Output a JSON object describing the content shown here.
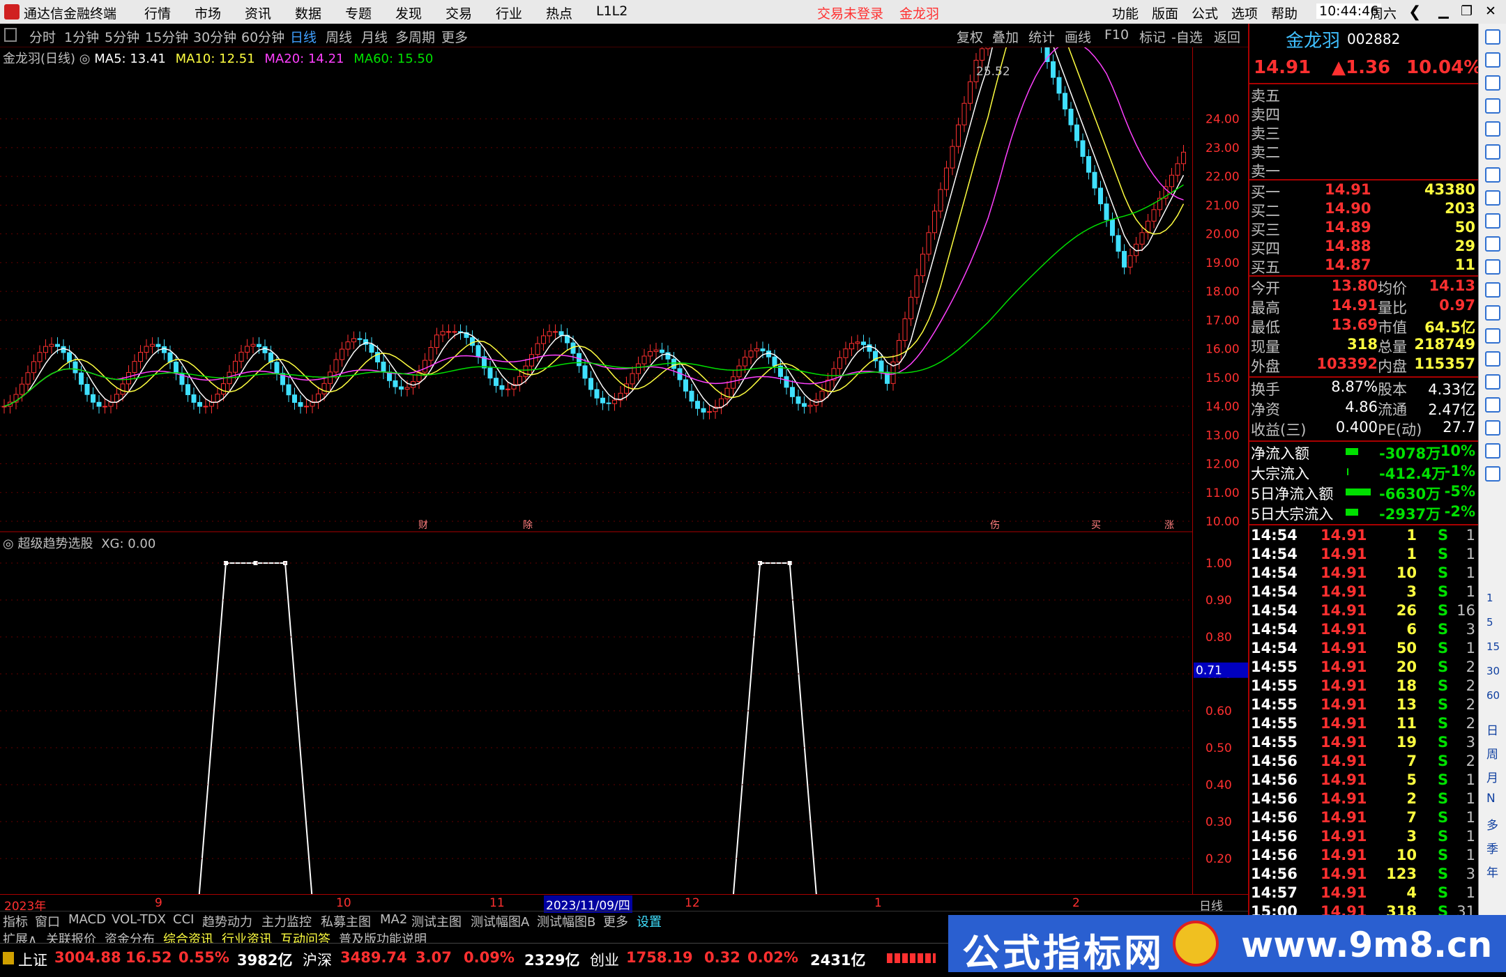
{
  "titlebar": {
    "app": "通达信金融终端",
    "menus": [
      "行情",
      "市场",
      "资讯",
      "数据",
      "专题",
      "发现",
      "交易",
      "行业",
      "热点",
      "L1L2"
    ],
    "login": "交易未登录",
    "stock": "金龙羽",
    "right_menus": [
      "功能",
      "版面",
      "公式",
      "选项",
      "帮助"
    ],
    "time": "10:44:46",
    "weekday": "周六"
  },
  "toolbar": {
    "periods": [
      "分时",
      "1分钟",
      "5分钟",
      "15分钟",
      "30分钟",
      "60分钟",
      "日线",
      "周线",
      "月线",
      "多周期",
      "更多"
    ],
    "active": "日线",
    "tools": [
      "复权",
      "叠加",
      "统计",
      "画线",
      "F10",
      "标记",
      "-自选",
      "返回"
    ]
  },
  "kline": {
    "title": "金龙羽(日线)",
    "ma5": "MA5: 13.41",
    "ma10": "MA10: 12.51",
    "ma20": "MA20: 14.21",
    "ma60": "MA60: 15.50",
    "high_label": "25.52",
    "yticks": [
      "24.00",
      "23.00",
      "22.00",
      "21.00",
      "20.00",
      "19.00",
      "18.00",
      "17.00",
      "16.00",
      "15.00",
      "14.00",
      "13.00",
      "12.00",
      "11.00",
      "10.00"
    ],
    "markers": [
      "财",
      "除",
      "伤",
      "买",
      "涨"
    ]
  },
  "indicator": {
    "title": "超级趋势选股",
    "value": "XG: 0.00",
    "yticks": [
      "1.00",
      "0.90",
      "0.80",
      "0.70",
      "0.60",
      "0.50",
      "0.40",
      "0.30",
      "0.20"
    ],
    "cursor": "0.71"
  },
  "chart_data": {
    "type": "line",
    "title": "超级趋势选股 XG",
    "ylim": [
      0,
      1
    ],
    "y": [
      0,
      0,
      0,
      0,
      0,
      0,
      0,
      1,
      1,
      1,
      0,
      0,
      0,
      0,
      0,
      0,
      0,
      0,
      0,
      0,
      0,
      0,
      0,
      0,
      0,
      1,
      1,
      0,
      0,
      0,
      0,
      0,
      0,
      0,
      0,
      0,
      0,
      0,
      0,
      0
    ]
  },
  "dates": {
    "labels": [
      "2023年",
      "9",
      "10",
      "11",
      "2023/11/09/四",
      "12",
      "1",
      "2"
    ],
    "period": "日线"
  },
  "tabs1": [
    "指标",
    "窗口",
    "MACD",
    "VOL-TDX",
    "CCI",
    "趋势动力",
    "主力监控",
    "私募主图",
    "MA2",
    "测试主图",
    "测试幅图A",
    "测试幅图B",
    "更多",
    "设置"
  ],
  "tabs2": [
    "扩展∧",
    "关联报价",
    "资金分布",
    "综合资讯",
    "行业资讯",
    "互动问答",
    "普及版功能说明"
  ],
  "quote": {
    "name": "金龙羽",
    "code": "002882",
    "price": "14.91",
    "change": "▲1.36",
    "pct": "10.04%",
    "sells": [
      "卖五",
      "卖四",
      "卖三",
      "卖二",
      "卖一"
    ],
    "buys": [
      [
        "买一",
        "14.91",
        "43380"
      ],
      [
        "买二",
        "14.90",
        "203"
      ],
      [
        "买三",
        "14.89",
        "50"
      ],
      [
        "买四",
        "14.88",
        "29"
      ],
      [
        "买五",
        "14.87",
        "11"
      ]
    ],
    "stats": [
      [
        "今开",
        "13.80",
        "均价",
        "14.13"
      ],
      [
        "最高",
        "14.91",
        "量比",
        "0.97"
      ],
      [
        "最低",
        "13.69",
        "市值",
        "64.5亿"
      ],
      [
        "现量",
        "318",
        "总量",
        "218749"
      ],
      [
        "外盘",
        "103392",
        "内盘",
        "115357"
      ]
    ],
    "fin": [
      [
        "换手",
        "8.87%",
        "股本",
        "4.33亿"
      ],
      [
        "净资",
        "4.86",
        "流通",
        "2.47亿"
      ],
      [
        "收益(三)",
        "0.400",
        "PE(动)",
        "27.7"
      ]
    ],
    "flows": [
      [
        "净流入额",
        "-3078万",
        "-10%"
      ],
      [
        "大宗流入",
        "-412.4万",
        "-1%"
      ],
      [
        "5日净流入额",
        "-6630万",
        "-5%"
      ],
      [
        "5日大宗流入",
        "-2937万",
        "-2%"
      ]
    ],
    "ticks": [
      [
        "14:54",
        "14.91",
        "1",
        "S",
        "1"
      ],
      [
        "14:54",
        "14.91",
        "1",
        "S",
        "1"
      ],
      [
        "14:54",
        "14.91",
        "10",
        "S",
        "1"
      ],
      [
        "14:54",
        "14.91",
        "3",
        "S",
        "1"
      ],
      [
        "14:54",
        "14.91",
        "26",
        "S",
        "16"
      ],
      [
        "14:54",
        "14.91",
        "6",
        "S",
        "3"
      ],
      [
        "14:54",
        "14.91",
        "50",
        "S",
        "1"
      ],
      [
        "14:55",
        "14.91",
        "20",
        "S",
        "2"
      ],
      [
        "14:55",
        "14.91",
        "18",
        "S",
        "2"
      ],
      [
        "14:55",
        "14.91",
        "13",
        "S",
        "2"
      ],
      [
        "14:55",
        "14.91",
        "11",
        "S",
        "2"
      ],
      [
        "14:55",
        "14.91",
        "19",
        "S",
        "3"
      ],
      [
        "14:56",
        "14.91",
        "7",
        "S",
        "2"
      ],
      [
        "14:56",
        "14.91",
        "5",
        "S",
        "1"
      ],
      [
        "14:56",
        "14.91",
        "2",
        "S",
        "1"
      ],
      [
        "14:56",
        "14.91",
        "7",
        "S",
        "1"
      ],
      [
        "14:56",
        "14.91",
        "3",
        "S",
        "1"
      ],
      [
        "14:56",
        "14.91",
        "10",
        "S",
        "1"
      ],
      [
        "14:56",
        "14.91",
        "123",
        "S",
        "3"
      ],
      [
        "14:57",
        "14.91",
        "4",
        "S",
        "1"
      ],
      [
        "15:00",
        "14.91",
        "318",
        "S",
        "31"
      ]
    ]
  },
  "sidebar": [
    "日",
    "周",
    "月",
    "N",
    "多",
    "季",
    "年"
  ],
  "sidebar_mins": [
    "1",
    "5",
    "15",
    "30",
    "60"
  ],
  "status": [
    [
      "上证",
      "3004.88",
      "16.52",
      "0.55%",
      "3982亿"
    ],
    [
      "沪深",
      "3489.74",
      "3.07",
      "0.09%",
      "2329亿"
    ],
    [
      "创业",
      "1758.19",
      "0.32",
      "0.02%",
      "2431亿"
    ]
  ],
  "watermark": {
    "text": "公式指标网",
    "url": "www.9m8.cn"
  }
}
